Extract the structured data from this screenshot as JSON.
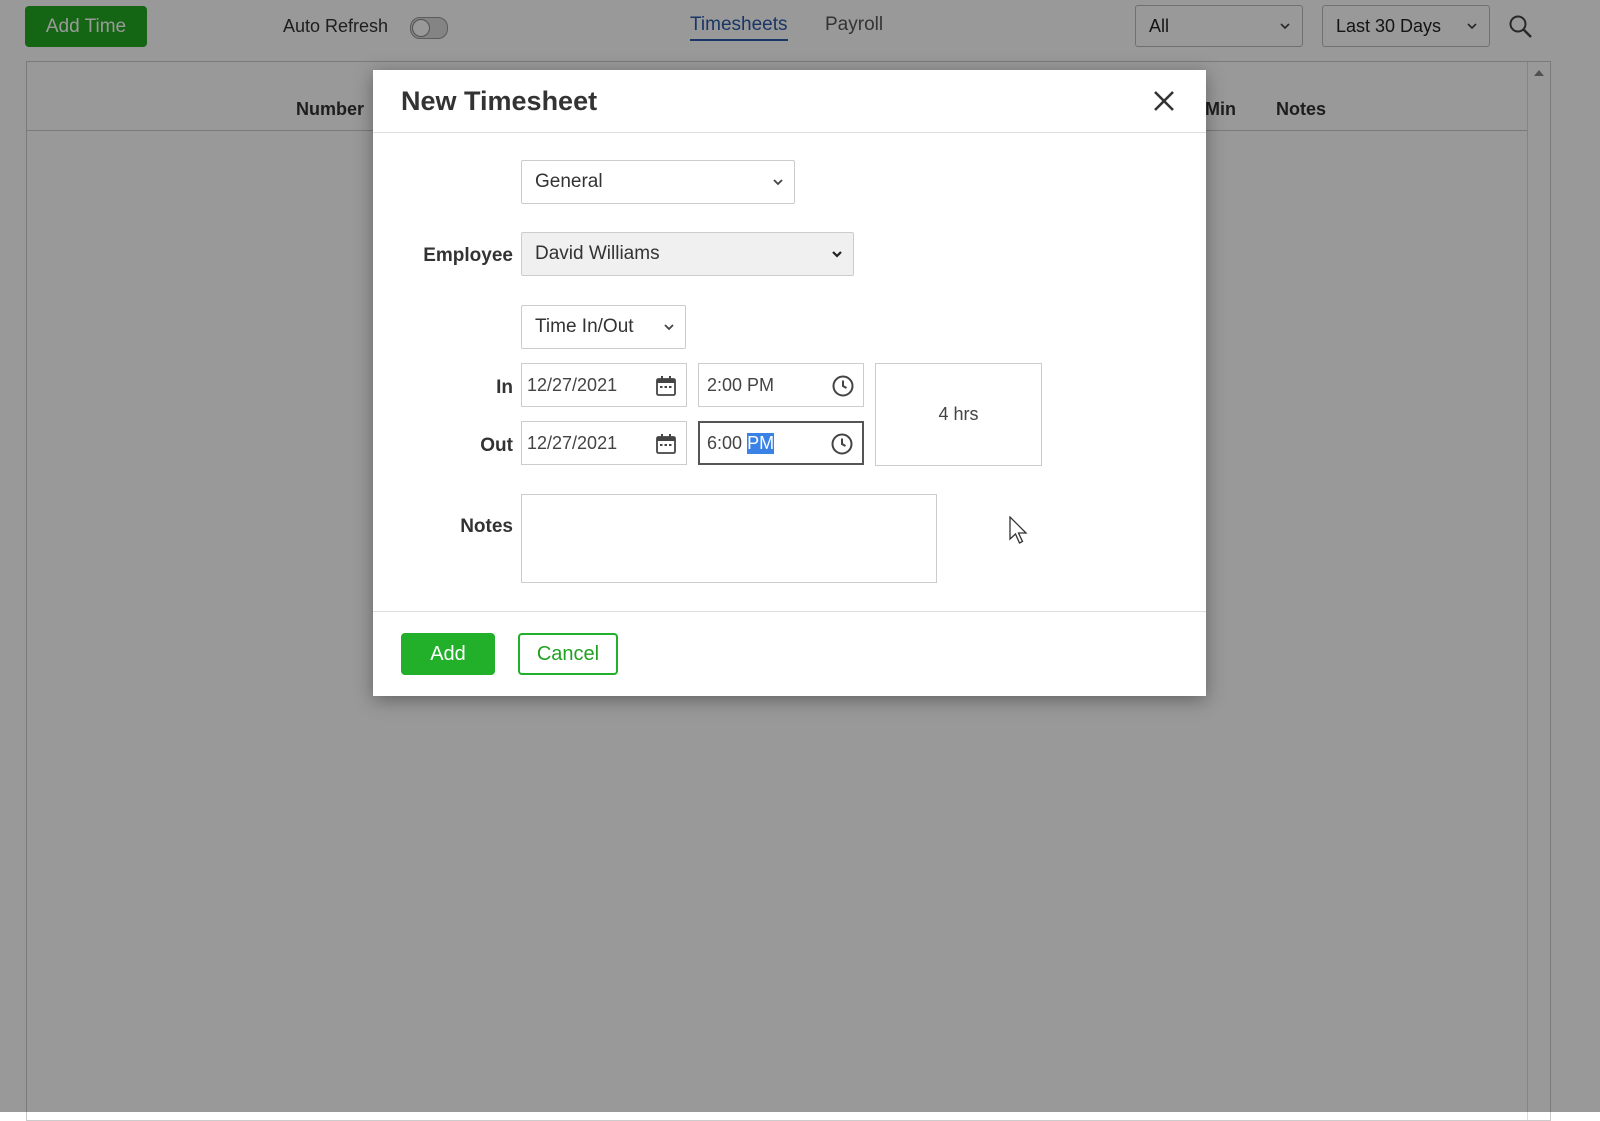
{
  "toolbar": {
    "add_time_label": "Add Time",
    "auto_refresh_label": "Auto Refresh",
    "auto_refresh_on": false,
    "tabs": [
      {
        "label": "Timesheets",
        "active": true
      },
      {
        "label": "Payroll",
        "active": false
      }
    ],
    "filter_value": "All",
    "range_value": "Last 30 Days"
  },
  "table": {
    "columns": [
      "Number",
      "Min",
      "Notes"
    ]
  },
  "modal": {
    "title": "New Timesheet",
    "category_value": "General",
    "employee_label": "Employee",
    "employee_value": "David Williams",
    "mode_value": "Time In/Out",
    "in_label": "In",
    "in_date": "12/27/2021",
    "in_time": "2:00 PM",
    "out_label": "Out",
    "out_date": "12/27/2021",
    "out_time_hour": "6:00",
    "out_time_period": "PM",
    "duration": "4 hrs",
    "notes_label": "Notes",
    "notes_value": "",
    "add_label": "Add",
    "cancel_label": "Cancel"
  },
  "colors": {
    "accent_green": "#22b02a",
    "link_blue": "#2a5aa8",
    "selection_blue": "#3b82e6"
  }
}
